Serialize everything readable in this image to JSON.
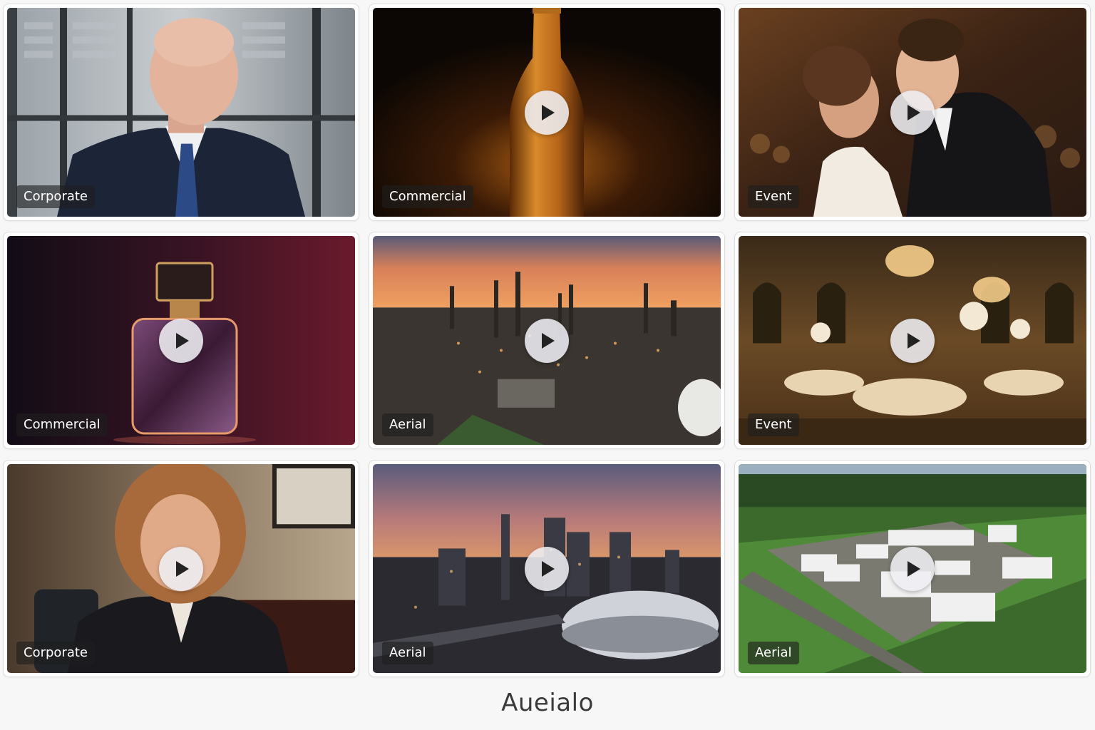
{
  "gallery": {
    "items": [
      {
        "category": "Corporate",
        "scene": "executive-interview",
        "has_play": false
      },
      {
        "category": "Commercial",
        "scene": "beer-bottle",
        "has_play": true
      },
      {
        "category": "Event",
        "scene": "wedding-couple",
        "has_play": true
      },
      {
        "category": "Commercial",
        "scene": "perfume-bottle",
        "has_play": true
      },
      {
        "category": "Aerial",
        "scene": "refinery-sunset",
        "has_play": true
      },
      {
        "category": "Event",
        "scene": "ballroom",
        "has_play": true
      },
      {
        "category": "Corporate",
        "scene": "woman-interview",
        "has_play": true
      },
      {
        "category": "Aerial",
        "scene": "city-skyline-stadium",
        "has_play": true
      },
      {
        "category": "Aerial",
        "scene": "industrial-campus",
        "has_play": true
      }
    ]
  },
  "footer": {
    "title": "Aueialo"
  },
  "colors": {
    "background": "#f7f7f7",
    "tag_background": "#1e1e1e",
    "play_button": "#eeeef2",
    "play_icon": "#222222",
    "footer_text": "#3a3a3a"
  }
}
